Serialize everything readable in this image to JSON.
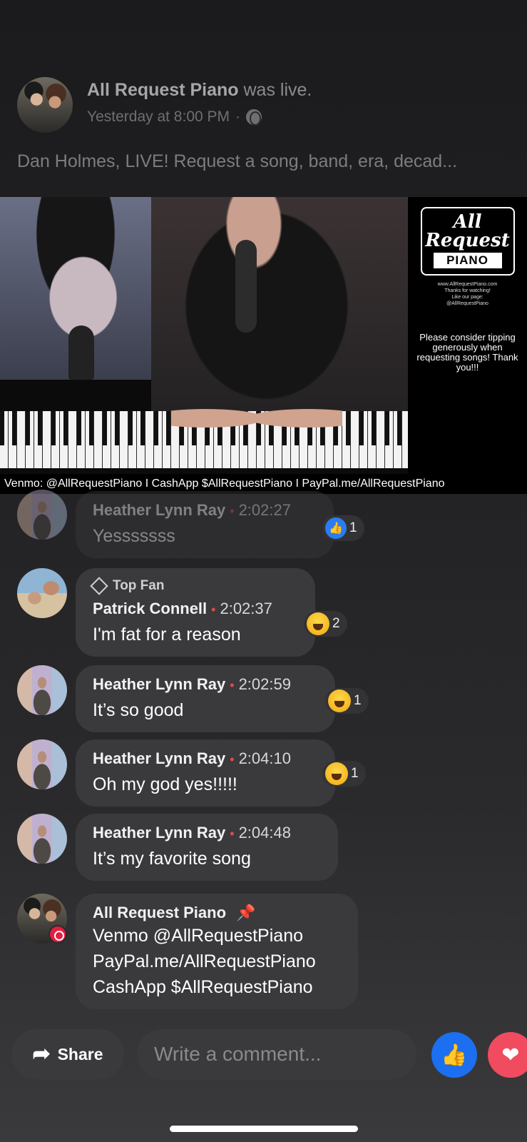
{
  "post": {
    "page_name": "All Request Piano",
    "action": "was live.",
    "timestamp": "Yesterday at 8:00 PM",
    "separator": "·",
    "description": "Dan Holmes, LIVE! Request a song, band, era, decad..."
  },
  "video": {
    "logo_all": "All",
    "logo_request": "Request",
    "logo_piano": "PIANO",
    "logo_site": "www.AllRequestPiano.com",
    "logo_thanks": "Thanks for watching!",
    "logo_like": "Like our page:",
    "logo_handle": "@AllRequestPiano",
    "tip_message": "Please consider tipping generously when requesting songs! Thank you!!!",
    "payments_bar": "Venmo: @AllRequestPiano   I   CashApp $AllRequestPiano   I   PayPal.me/AllRequestPiano"
  },
  "comments": [
    {
      "author": "Heather Lynn Ray",
      "time": "2:02:27",
      "text": "Yesssssss",
      "reaction": "like",
      "reaction_count": "1",
      "dim": true
    },
    {
      "badge": "Top Fan",
      "author": "Patrick Connell",
      "time": "2:02:37",
      "text": "I'm fat for a reason",
      "reaction": "haha",
      "reaction_count": "2"
    },
    {
      "author": "Heather Lynn Ray",
      "time": "2:02:59",
      "text": "It’s so good",
      "reaction": "haha",
      "reaction_count": "1"
    },
    {
      "author": "Heather Lynn Ray",
      "time": "2:04:10",
      "text": "Oh my god yes!!!!!",
      "reaction": "haha",
      "reaction_count": "1"
    },
    {
      "author": "Heather Lynn Ray",
      "time": "2:04:48",
      "text": "It’s my favorite song"
    },
    {
      "author": "All Request Piano",
      "pinned": true,
      "lines": [
        "Venmo @AllRequestPiano",
        "PayPal.me/AllRequestPiano",
        "CashApp $AllRequestPiano"
      ]
    }
  ],
  "dot": "•",
  "actions": {
    "share_label": "Share",
    "comment_placeholder": "Write a comment..."
  },
  "icons": [
    "globe-icon",
    "diamond-icon",
    "pin-icon",
    "share-icon",
    "like-icon",
    "love-icon",
    "haha-emoji-icon",
    "like-reaction-icon",
    "live-badge-icon"
  ],
  "colors": {
    "like_blue": "#1b6ff0",
    "love_red": "#f14b5f",
    "bubble": "#3a3a3c",
    "timestamp_dot": "#e34b4b"
  }
}
